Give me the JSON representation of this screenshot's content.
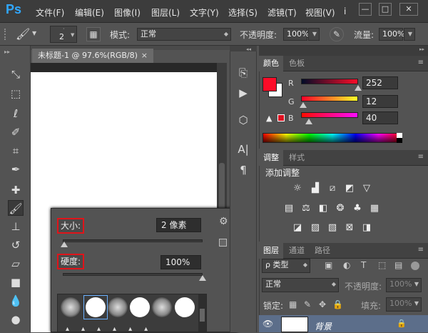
{
  "app": {
    "logo": "Ps"
  },
  "menu": [
    "文件(F)",
    "编辑(E)",
    "图像(I)",
    "图层(L)",
    "文字(Y)",
    "选择(S)",
    "滤镜(T)",
    "视图(V)",
    "i"
  ],
  "window_controls": {
    "minimize": "—",
    "restore": "□",
    "close": "✕"
  },
  "options": {
    "brush_size": "2",
    "mode_label": "模式:",
    "mode_value": "正常",
    "opacity_label": "不透明度:",
    "opacity_value": "100%",
    "flow_label": "流量:",
    "flow_value": "100%"
  },
  "document": {
    "tab_title": "未标题-1 @ 97.6%(RGB/8)",
    "tab_close": "×"
  },
  "brush_popup": {
    "size_label": "大小:",
    "size_value": "2 像素",
    "hardness_label": "硬度:",
    "hardness_value": "100%",
    "size_fraction": 0.01,
    "hardness_fraction": 1.0
  },
  "color_panel": {
    "tabs": [
      "颜色",
      "色板"
    ],
    "r_label": "R",
    "r_value": "252",
    "g_label": "G",
    "g_value": "12",
    "b_label": "B",
    "b_value": "40",
    "foreground": "#fc0c28",
    "background": "#ffffff"
  },
  "adjust_panel": {
    "tabs": [
      "调整",
      "样式"
    ],
    "title": "添加调整"
  },
  "layers_panel": {
    "tabs": [
      "图层",
      "通道",
      "路径"
    ],
    "filter_label": "ρ 类型",
    "blend_mode": "正常",
    "opacity_label": "不透明度:",
    "opacity_value": "100%",
    "lock_label": "锁定:",
    "fill_label": "填充:",
    "fill_value": "100%",
    "layer_name": "背景"
  }
}
